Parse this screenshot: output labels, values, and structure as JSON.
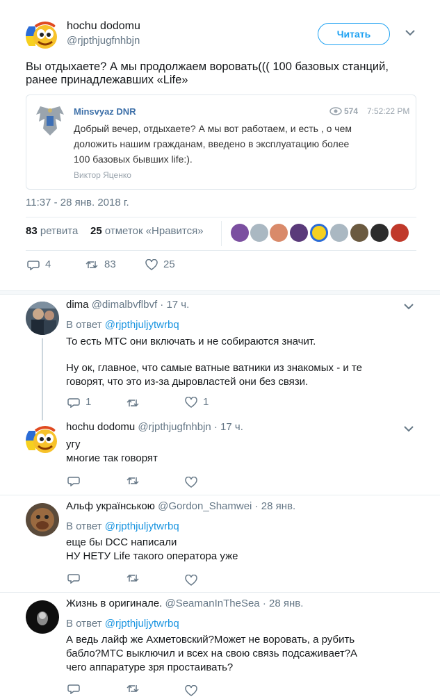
{
  "colors": {
    "accent": "#1da1f2",
    "link": "#1b95e0",
    "muted": "#657786",
    "divider": "#e6ecf0"
  },
  "main": {
    "author_name": "hochu dodomu",
    "author_handle": "@rjpthjugfnhbjn",
    "follow_label": "Читать",
    "text_line1": "Вы отдыхаете? А мы продолжаем воровать((( 100 базовых станций,",
    "text_line2": "ранее принадлежавших «Life»",
    "quote": {
      "channel": "Minsvyaz DNR",
      "views": "574",
      "time": "7:52:22 PM",
      "line1": "Добрый вечер, отдыхаете? А мы вот работаем, и есть , о чем",
      "line2": "доложить нашим гражданам, введено в эксплуатацию более",
      "line3": "100 базовых бывших life:).",
      "signature": "Виктор Яценко"
    },
    "timestamp": "11:37 - 28 янв. 2018 г.",
    "retweets_count": "83",
    "retweets_label": "ретвита",
    "likes_count": "25",
    "likes_label": "отметок «Нравится»",
    "actions": {
      "replies": "4",
      "retweets": "83",
      "likes": "25"
    }
  },
  "replies": [
    {
      "name": "dima",
      "handle": "@dimalbvflbvf",
      "time": "· 17 ч.",
      "reply_to_prefix": "В ответ",
      "reply_to": "@rjpthjuljytwrbq",
      "line1": "То есть МТС они включать и не собираются значит.",
      "line2": "Ну ок, главное, что самые ватные ватники из знакомых - и те",
      "line3": "говорят, что это из-за дыровластей они без связи.",
      "reply_count": "1",
      "like_count": "1"
    },
    {
      "name": "hochu dodomu",
      "handle": "@rjpthjugfnhbjn",
      "time": "· 17 ч.",
      "line1": "угу",
      "line2": "многие так говорят"
    },
    {
      "name": "Альф українською",
      "handle": "@Gordon_Shamwei",
      "time": "· 28 янв.",
      "reply_to_prefix": "В ответ",
      "reply_to": "@rjpthjuljytwrbq",
      "line1": "еще бы DCC написали",
      "line2": "НУ НЕТУ Life такого оператора уже"
    },
    {
      "name": "Жизнь в оригинале.",
      "handle": "@SeamanInTheSea",
      "time": "· 28 янв.",
      "reply_to_prefix": "В ответ",
      "reply_to": "@rjpthjuljytwrbq",
      "line1": "А ведь лайф же Ахметовский?Может не воровать, а рубить",
      "line2": "бабло?МТС выключил и всех на свою связь подсаживает?А",
      "line3": "чего аппаратуре зря простаивать?"
    }
  ]
}
